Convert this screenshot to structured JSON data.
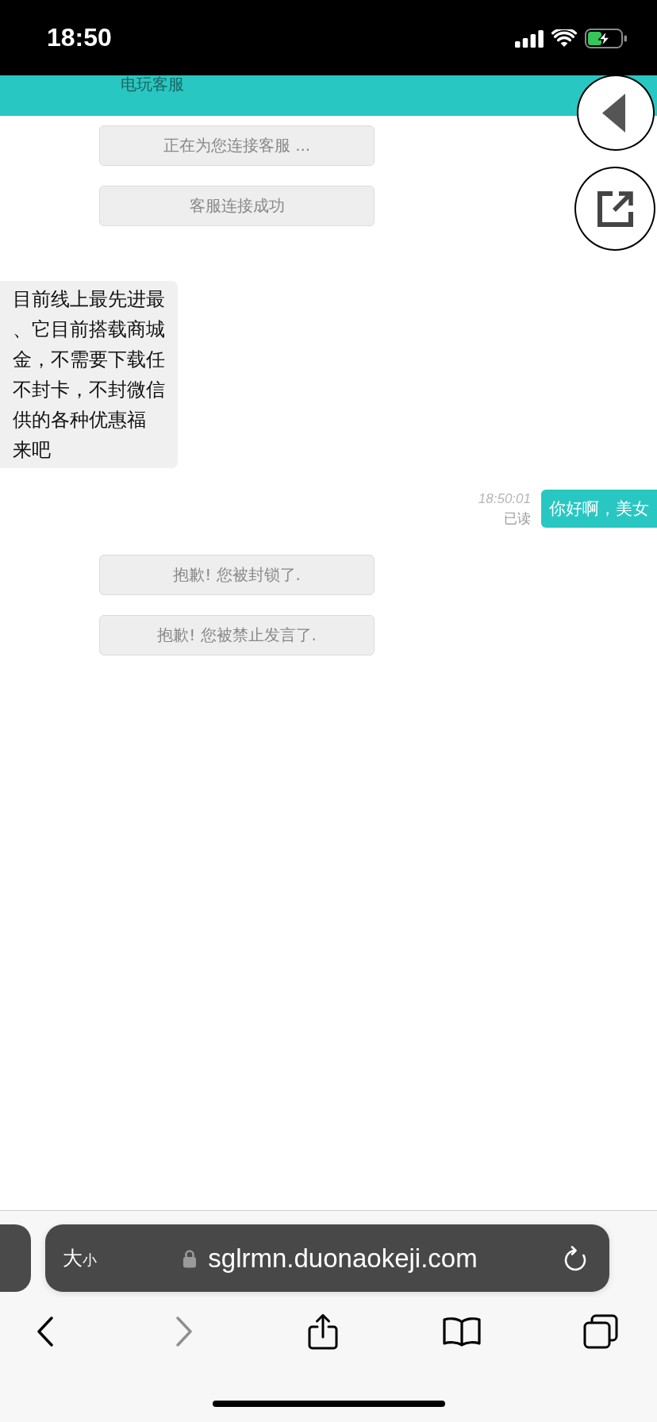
{
  "status_bar": {
    "time": "18:50"
  },
  "header": {
    "title": "电玩客服"
  },
  "messages": [
    {
      "kind": "notice",
      "text": "正在为您连接客服 ..."
    },
    {
      "kind": "notice",
      "text": "客服连接成功"
    },
    {
      "kind": "received",
      "lines": [
        "目前线上最先进最",
        "、它目前搭载商城",
        "金，不需要下载任",
        "不封卡，不封微信",
        "供的各种优惠福",
        "来吧"
      ]
    },
    {
      "kind": "sent",
      "time": "18:50:01",
      "receipt": "已读",
      "text": "你好啊，美女"
    },
    {
      "kind": "notice",
      "text": "抱歉! 您被封锁了."
    },
    {
      "kind": "notice",
      "text": "抱歉! 您被禁止发言了."
    }
  ],
  "address_bar": {
    "text_size_large": "大",
    "text_size_small": "小",
    "url": "sglrmn.duonaokeji.com"
  },
  "toolbar": [
    {
      "kind": "back",
      "disabled": false
    },
    {
      "kind": "forward",
      "disabled": true
    },
    {
      "kind": "share",
      "disabled": false
    },
    {
      "kind": "bookmarks",
      "disabled": false
    },
    {
      "kind": "tabs",
      "disabled": false
    }
  ]
}
